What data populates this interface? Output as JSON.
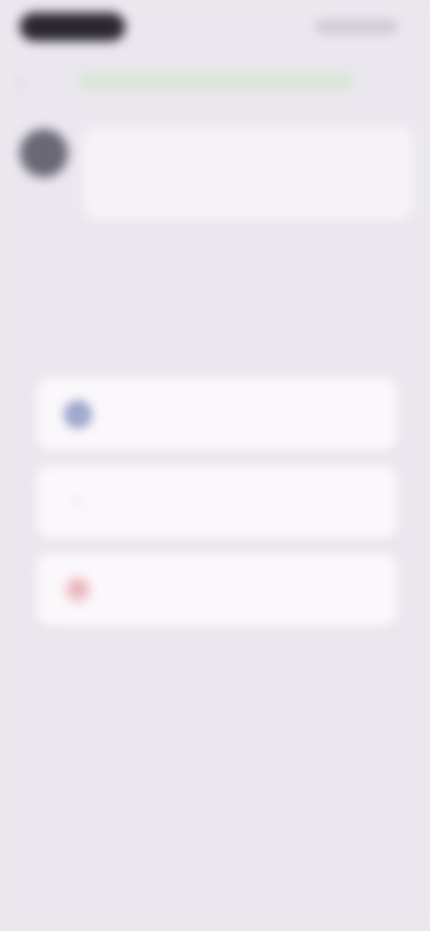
{
  "status_bar": {
    "time": "",
    "indicators": ""
  },
  "header": {
    "title": ""
  },
  "message": {
    "text": ""
  },
  "options": [
    {
      "label": "",
      "icon": "user-icon",
      "icon_color": "#8b93c2"
    },
    {
      "label": "",
      "icon": "star-icon",
      "icon_color": "#c8c6cc"
    },
    {
      "label": "",
      "icon": "flag-icon",
      "icon_color": "#d47e8b"
    }
  ],
  "colors": {
    "background": "#ebe7ee",
    "card": "#fbf8fc",
    "accent_green": "#dbe6d8"
  }
}
